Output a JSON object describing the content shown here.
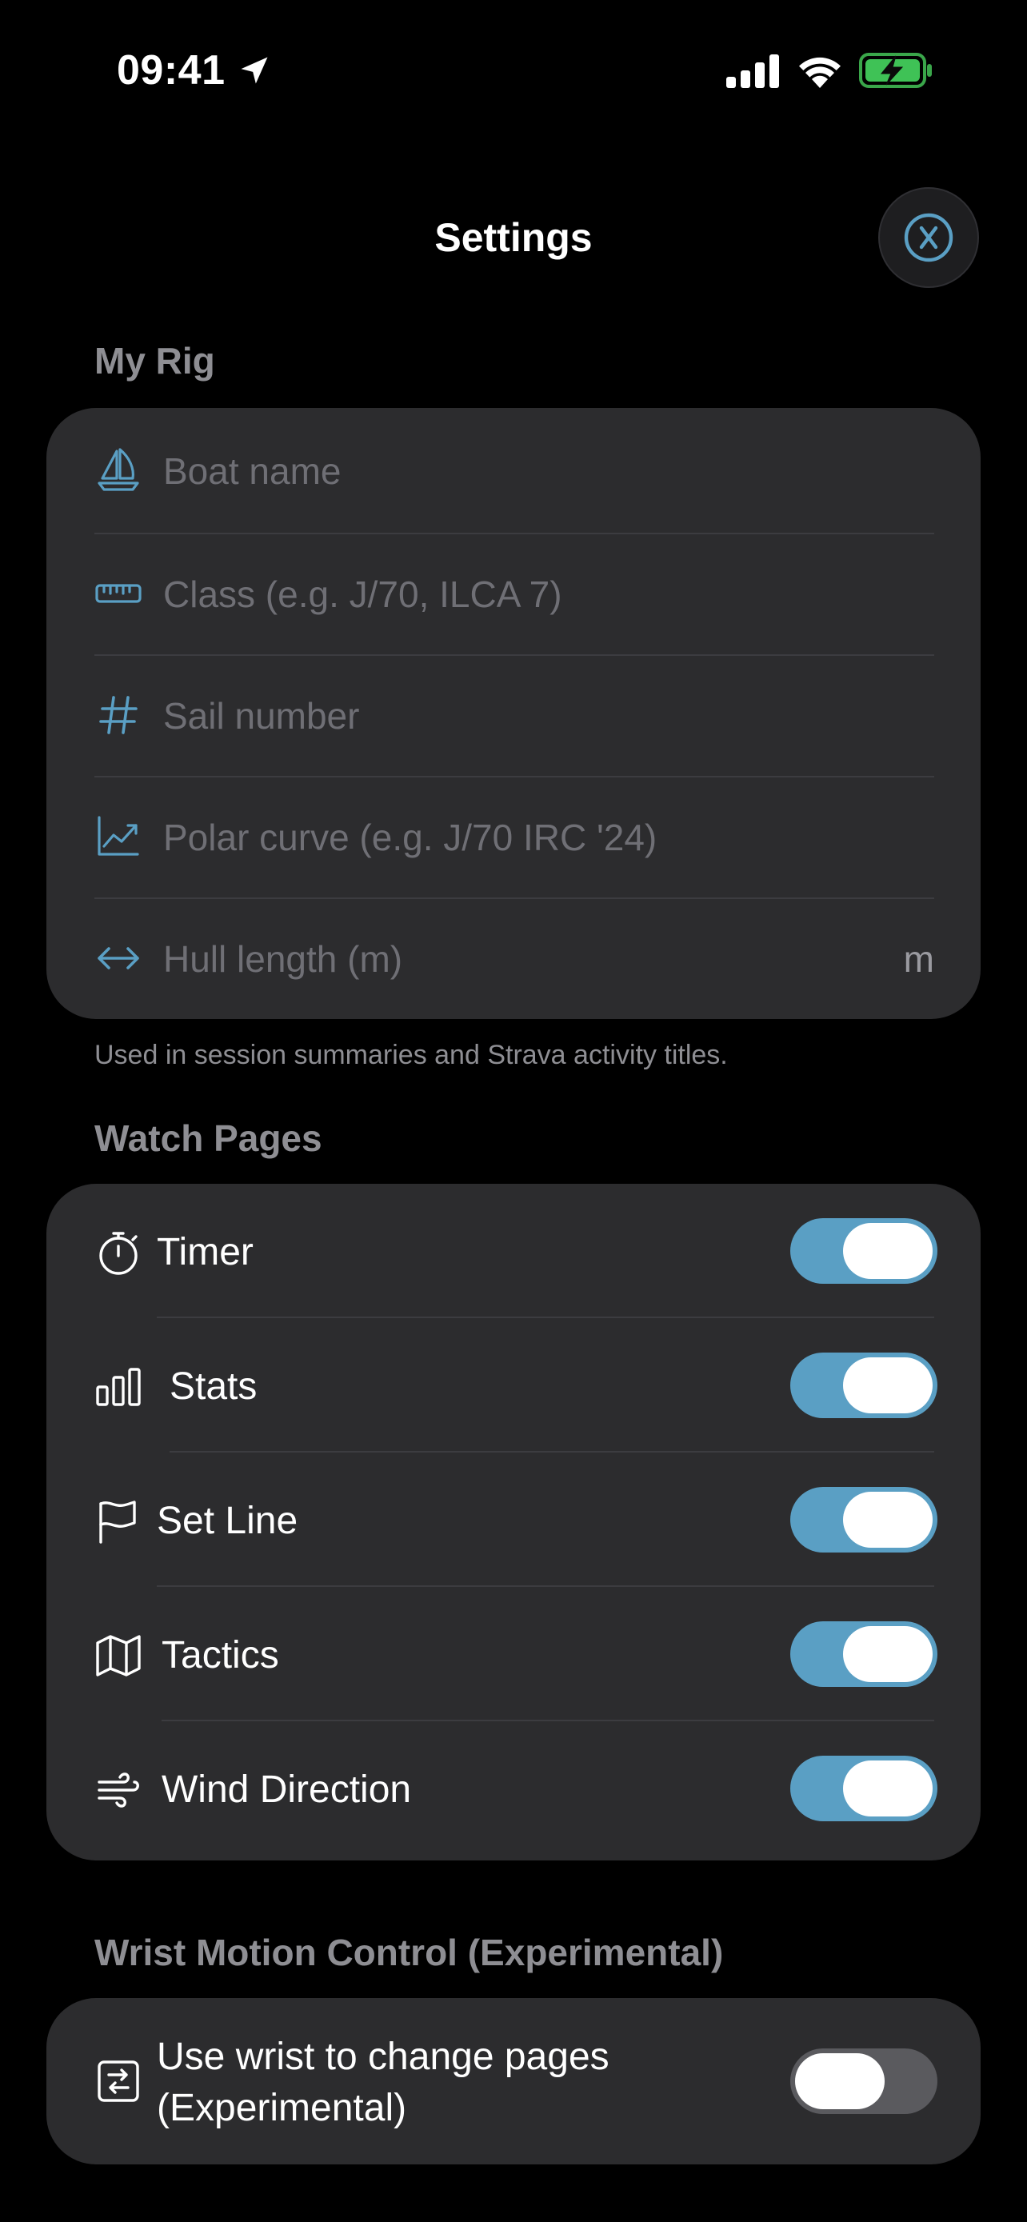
{
  "status_bar": {
    "time": "09:41"
  },
  "header": {
    "title": "Settings"
  },
  "my_rig": {
    "title": "My Rig",
    "fields": [
      {
        "icon": "sailboat-icon",
        "placeholder": "Boat name"
      },
      {
        "icon": "ruler-icon",
        "placeholder": "Class (e.g. J/70, ILCA 7)"
      },
      {
        "icon": "hash-icon",
        "placeholder": "Sail number"
      },
      {
        "icon": "chart-line-icon",
        "placeholder": "Polar curve (e.g. J/70 IRC '24)"
      },
      {
        "icon": "arrows-horizontal-icon",
        "placeholder": "Hull length (m)",
        "unit": "m"
      }
    ],
    "footnote": "Used in session summaries and Strava activity titles."
  },
  "watch_pages": {
    "title": "Watch Pages",
    "items": [
      {
        "icon": "stopwatch-icon",
        "label": "Timer",
        "enabled": true
      },
      {
        "icon": "bar-chart-icon",
        "label": "Stats",
        "enabled": true
      },
      {
        "icon": "flag-icon",
        "label": "Set Line",
        "enabled": true
      },
      {
        "icon": "map-icon",
        "label": "Tactics",
        "enabled": true
      },
      {
        "icon": "wind-icon",
        "label": "Wind Direction",
        "enabled": true
      }
    ]
  },
  "wrist_motion": {
    "title": "Wrist Motion Control (Experimental)",
    "item": {
      "icon": "switch-pages-icon",
      "label_line1": "Use wrist to change pages",
      "label_line2": "(Experimental)",
      "enabled": false
    }
  },
  "colors": {
    "accent": "#5a9fc4",
    "card": "#2c2c2e",
    "background": "#000000",
    "muted": "#8e8e93"
  }
}
